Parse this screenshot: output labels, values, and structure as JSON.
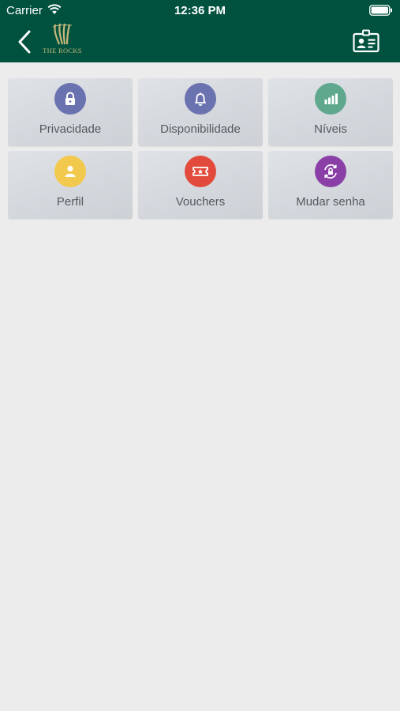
{
  "status_bar": {
    "carrier": "Carrier",
    "time": "12:36 PM"
  },
  "header": {
    "back_icon": "chevron-left-icon",
    "logo_text": "THE ROCKS",
    "right_icon": "id-card-icon",
    "background_color": "#00523f"
  },
  "menu": {
    "items": [
      {
        "label": "Privacidade",
        "icon": "lock-icon",
        "color": "#6b72b0"
      },
      {
        "label": "Disponibilidade",
        "icon": "bell-icon",
        "color": "#6b72b0"
      },
      {
        "label": "Níveis",
        "icon": "signal-bars-icon",
        "color": "#5fa88e"
      },
      {
        "label": "Perfil",
        "icon": "user-icon",
        "color": "#f2c94c"
      },
      {
        "label": "Vouchers",
        "icon": "ticket-icon",
        "color": "#e24b3b"
      },
      {
        "label": "Mudar senha",
        "icon": "lock-refresh-icon",
        "color": "#8a3fa6"
      }
    ]
  }
}
